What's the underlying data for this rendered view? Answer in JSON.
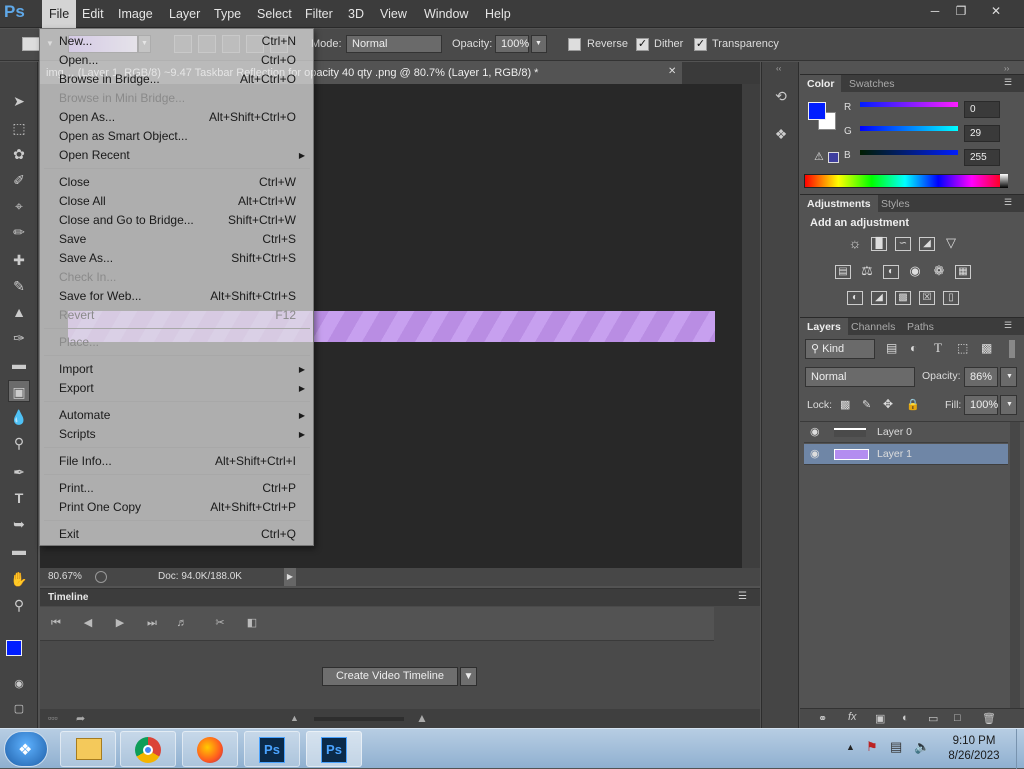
{
  "menubar": {
    "logo": "Ps",
    "items": [
      "File",
      "Edit",
      "Image",
      "Layer",
      "Type",
      "Select",
      "Filter",
      "3D",
      "View",
      "Window",
      "Help"
    ]
  },
  "options": {
    "mode_label": "Mode:",
    "mode_value": "Normal",
    "opacity_label": "Opacity:",
    "opacity_value": "100%",
    "reverse_label": "Reverse",
    "dither_label": "Dither",
    "transparency_label": "Transparency"
  },
  "document": {
    "tab_title": "img… (Layer 1, RGB/8)  ~9.47 Taskbar Reflection for opacity 40 qty .png @ 80.7% (Layer 1, RGB/8) *",
    "zoom": "80.67%",
    "doc_size": "Doc: 94.0K/188.0K"
  },
  "file_menu": [
    {
      "label": "New...",
      "shortcut": "Ctrl+N",
      "disabled": false
    },
    {
      "label": "Open...",
      "shortcut": "Ctrl+O",
      "disabled": false
    },
    {
      "label": "Browse in Bridge...",
      "shortcut": "Alt+Ctrl+O",
      "disabled": false
    },
    {
      "label": "Browse in Mini Bridge...",
      "shortcut": "",
      "disabled": true
    },
    {
      "label": "Open As...",
      "shortcut": "Alt+Shift+Ctrl+O",
      "disabled": false
    },
    {
      "label": "Open as Smart Object...",
      "shortcut": "",
      "disabled": false
    },
    {
      "label": "Open Recent",
      "shortcut": "",
      "submenu": true,
      "disabled": false
    },
    {
      "sep": true
    },
    {
      "label": "Close",
      "shortcut": "Ctrl+W",
      "disabled": false
    },
    {
      "label": "Close All",
      "shortcut": "Alt+Ctrl+W",
      "disabled": false
    },
    {
      "label": "Close and Go to Bridge...",
      "shortcut": "Shift+Ctrl+W",
      "disabled": false
    },
    {
      "label": "Save",
      "shortcut": "Ctrl+S",
      "disabled": false
    },
    {
      "label": "Save As...",
      "shortcut": "Shift+Ctrl+S",
      "disabled": false
    },
    {
      "label": "Check In...",
      "shortcut": "",
      "disabled": true
    },
    {
      "label": "Save for Web...",
      "shortcut": "Alt+Shift+Ctrl+S",
      "disabled": false
    },
    {
      "label": "Revert",
      "shortcut": "F12",
      "disabled": true
    },
    {
      "sep": true
    },
    {
      "label": "Place...",
      "shortcut": "",
      "disabled": true
    },
    {
      "sep": true
    },
    {
      "label": "Import",
      "shortcut": "",
      "submenu": true,
      "disabled": false
    },
    {
      "label": "Export",
      "shortcut": "",
      "submenu": true,
      "disabled": false
    },
    {
      "sep": true
    },
    {
      "label": "Automate",
      "shortcut": "",
      "submenu": true,
      "disabled": false
    },
    {
      "label": "Scripts",
      "shortcut": "",
      "submenu": true,
      "disabled": false
    },
    {
      "sep": true
    },
    {
      "label": "File Info...",
      "shortcut": "Alt+Shift+Ctrl+I",
      "disabled": false
    },
    {
      "sep": true
    },
    {
      "label": "Print...",
      "shortcut": "Ctrl+P",
      "disabled": false
    },
    {
      "label": "Print One Copy",
      "shortcut": "Alt+Shift+Ctrl+P",
      "disabled": false
    },
    {
      "sep": true
    },
    {
      "label": "Exit",
      "shortcut": "Ctrl+Q",
      "disabled": false
    }
  ],
  "timeline": {
    "title": "Timeline",
    "create_button": "Create Video Timeline"
  },
  "color_panel": {
    "tabs": [
      "Color",
      "Swatches"
    ],
    "r_label": "R",
    "r_value": "0",
    "g_label": "G",
    "g_value": "29",
    "b_label": "B",
    "b_value": "255",
    "foreground": "#001dff"
  },
  "adjustments_panel": {
    "tabs": [
      "Adjustments",
      "Styles"
    ],
    "heading": "Add an adjustment"
  },
  "layers_panel": {
    "tabs": [
      "Layers",
      "Channels",
      "Paths"
    ],
    "kind_label": "Kind",
    "blend_mode": "Normal",
    "opacity_label": "Opacity:",
    "opacity_value": "86%",
    "lock_label": "Lock:",
    "fill_label": "Fill:",
    "fill_value": "100%",
    "layers": [
      "Layer 0",
      "Layer 1"
    ],
    "selected_layer": "Layer 1"
  },
  "taskbar": {
    "time": "9:10 PM",
    "date": "8/26/2023",
    "apps": [
      "File Explorer",
      "Google Chrome",
      "Firefox",
      "Photoshop",
      "Photoshop"
    ]
  },
  "colors": {
    "selection": "#6f86a6",
    "gradient_swatch": "#b38df0"
  }
}
